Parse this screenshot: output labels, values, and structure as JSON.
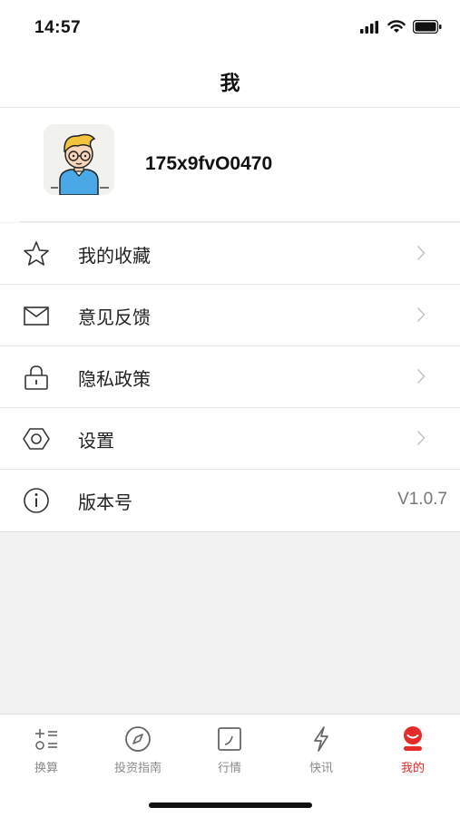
{
  "status_bar": {
    "time": "14:57"
  },
  "header": {
    "title": "我"
  },
  "profile": {
    "username": "175x9fvO0470"
  },
  "menu": [
    {
      "label": "我的收藏",
      "icon": "star-icon",
      "trailing": "chevron"
    },
    {
      "label": "意见反馈",
      "icon": "mail-icon",
      "trailing": "chevron"
    },
    {
      "label": "隐私政策",
      "icon": "lock-icon",
      "trailing": "chevron"
    },
    {
      "label": "设置",
      "icon": "hexagon-settings-icon",
      "trailing": "chevron"
    },
    {
      "label": "版本号",
      "icon": "info-icon",
      "trailing": "value",
      "value": "V1.0.7"
    }
  ],
  "tabs": [
    {
      "label": "换算",
      "icon": "calculator-icon",
      "active": false
    },
    {
      "label": "投资指南",
      "icon": "compass-icon",
      "active": false
    },
    {
      "label": "行情",
      "icon": "chart-icon",
      "active": false
    },
    {
      "label": "快讯",
      "icon": "lightning-icon",
      "active": false
    },
    {
      "label": "我的",
      "icon": "profile-icon",
      "active": true
    }
  ],
  "colors": {
    "accent": "#e62b2b",
    "inactive": "#8a8a8a",
    "background": "#f2f2f2"
  }
}
